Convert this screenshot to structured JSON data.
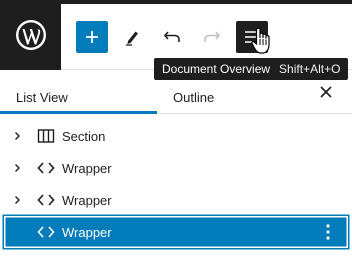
{
  "toolbar": {
    "items": [
      {
        "icon": "wordpress-icon"
      },
      {
        "icon": "plus-icon"
      },
      {
        "icon": "pencil-icon"
      },
      {
        "icon": "undo-icon"
      },
      {
        "icon": "redo-icon"
      },
      {
        "icon": "list-view-icon"
      }
    ]
  },
  "tooltip": {
    "label": "Document Overview",
    "shortcut": "Shift+Alt+O"
  },
  "panel": {
    "tabs": [
      {
        "label": "List View",
        "active": true
      },
      {
        "label": "Outline",
        "active": false
      }
    ],
    "close_icon": "close-icon"
  },
  "list": {
    "items": [
      {
        "label": "Section",
        "icon": "section-icon",
        "expandable": true,
        "selected": false
      },
      {
        "label": "Wrapper",
        "icon": "code-icon",
        "expandable": true,
        "selected": false
      },
      {
        "label": "Wrapper",
        "icon": "code-icon",
        "expandable": true,
        "selected": false
      },
      {
        "label": "Wrapper",
        "icon": "code-icon",
        "expandable": false,
        "selected": true
      }
    ]
  },
  "colors": {
    "accent": "#007cba",
    "dark": "#1e1e1e",
    "border": "#e0e0e0"
  }
}
